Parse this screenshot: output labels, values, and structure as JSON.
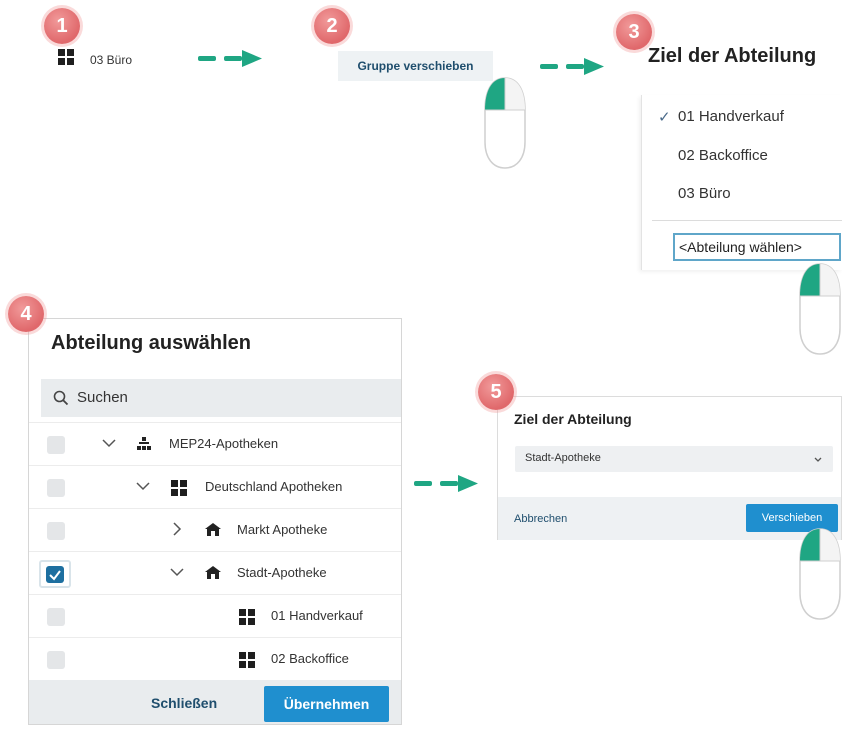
{
  "steps": {
    "s1": "1",
    "s2": "2",
    "s3": "3",
    "s4": "4",
    "s5": "5"
  },
  "step1": {
    "group_label": "03 Büro"
  },
  "step2": {
    "move_group_label": "Gruppe verschieben"
  },
  "step3": {
    "title": "Ziel der Abteilung",
    "options": [
      "01 Handverkauf",
      "02 Backoffice",
      "03 Büro"
    ],
    "selected_mark": "✓",
    "select_value": "<Abteilung wählen>"
  },
  "step4": {
    "title": "Abteilung auswählen",
    "search_placeholder": "Suchen",
    "rows": [
      {
        "label": "MEP24-Apotheken",
        "checked": false
      },
      {
        "label": "Deutschland Apotheken",
        "checked": false
      },
      {
        "label": "Markt Apotheke",
        "checked": false
      },
      {
        "label": "Stadt-Apotheke",
        "checked": true
      },
      {
        "label": "01 Handverkauf",
        "checked": false
      },
      {
        "label": "02 Backoffice",
        "checked": false
      }
    ],
    "close_label": "Schließen",
    "apply_label": "Übernehmen"
  },
  "step5": {
    "title": "Ziel der Abteilung",
    "select_value": "Stadt-Apotheke",
    "cancel_label": "Abbrechen",
    "move_label": "Verschieben"
  },
  "colors": {
    "badge": "#e0686b",
    "arrow": "#1fa683",
    "primary_button": "#1f8fcf",
    "link": "#1f4e6d"
  }
}
